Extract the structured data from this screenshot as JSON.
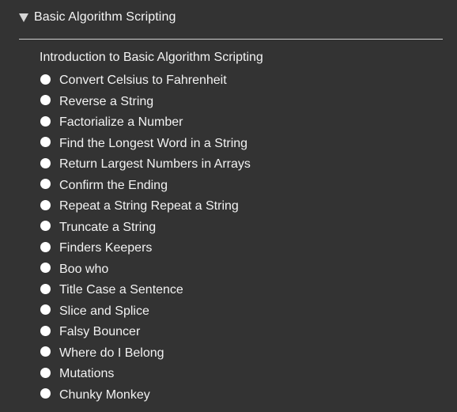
{
  "section": {
    "title": "Basic Algorithm Scripting",
    "expanded": true,
    "intro_label": "Introduction to Basic Algorithm Scripting",
    "challenges": [
      {
        "label": "Convert Celsius to Fahrenheit"
      },
      {
        "label": "Reverse a String"
      },
      {
        "label": "Factorialize a Number"
      },
      {
        "label": "Find the Longest Word in a String"
      },
      {
        "label": "Return Largest Numbers in Arrays"
      },
      {
        "label": "Confirm the Ending"
      },
      {
        "label": "Repeat a String Repeat a String"
      },
      {
        "label": "Truncate a String"
      },
      {
        "label": "Finders Keepers"
      },
      {
        "label": "Boo who"
      },
      {
        "label": "Title Case a Sentence"
      },
      {
        "label": "Slice and Splice"
      },
      {
        "label": "Falsy Bouncer"
      },
      {
        "label": "Where do I Belong"
      },
      {
        "label": "Mutations"
      },
      {
        "label": "Chunky Monkey"
      }
    ]
  },
  "colors": {
    "background": "#333333",
    "text": "#f2f2f2",
    "divider": "#d0d0d0",
    "incomplete_dot": "#ffffff",
    "caret": "#d6d6d6"
  },
  "icons": {
    "caret": "caret-down-icon",
    "status": "circle-icon"
  }
}
